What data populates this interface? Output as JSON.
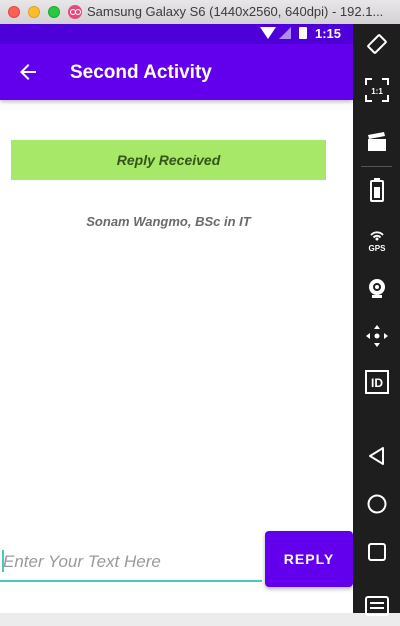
{
  "window": {
    "title": "Samsung Galaxy S6 (1440x2560, 640dpi) - 192.1..."
  },
  "status_bar": {
    "time": "1:15"
  },
  "app_bar": {
    "title": "Second Activity",
    "back_icon": "arrow-back-icon"
  },
  "content": {
    "reply_header": "Reply Received",
    "reply_message": "Sonam Wangmo, BSc in IT"
  },
  "input": {
    "value": "",
    "placeholder": "Enter Your Text Here"
  },
  "reply_button": {
    "label": "REPLY"
  },
  "toolbar": {
    "items": [
      {
        "icon": "rotate-icon"
      },
      {
        "icon": "scale-icon",
        "label": "1:1"
      },
      {
        "icon": "screen-record-icon"
      },
      {
        "icon": "battery-icon"
      },
      {
        "icon": "gps-icon",
        "label": "GPS"
      },
      {
        "icon": "camera-icon"
      },
      {
        "icon": "dpad-icon"
      },
      {
        "icon": "id-icon",
        "label": "ID"
      },
      {
        "icon": "back-icon"
      },
      {
        "icon": "home-icon"
      },
      {
        "icon": "overview-icon"
      },
      {
        "icon": "menu-icon"
      }
    ]
  },
  "colors": {
    "primary": "#6200ee",
    "primary_dark": "#4e00d8",
    "reply_banner": "#a8e868",
    "accent": "#46c9c2"
  }
}
